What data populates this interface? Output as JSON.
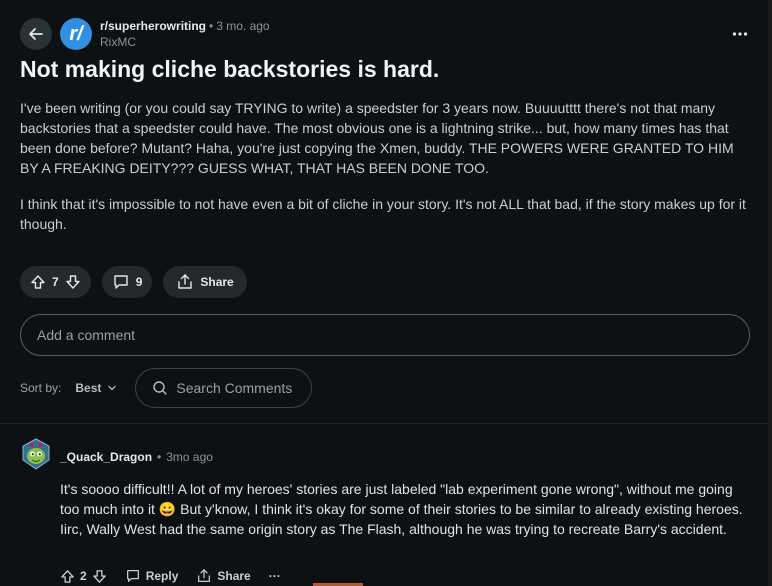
{
  "post": {
    "subreddit": "r/superherowriting",
    "age": "3 mo. ago",
    "author": "RixMC",
    "title": "Not making cliche backstories is hard.",
    "paragraphs": [
      "I've been writing (or you could say TRYING to write) a speedster for 3 years now. Buuuutttt there's not that many backstories that a speedster could have. The most obvious one is a lightning strike... but, how many times has that been done before? Mutant? Haha, you're just copying the Xmen, buddy. THE POWERS WERE GRANTED TO HIM BY A FREAKING DEITY??? GUESS WHAT, THAT HAS BEEN DONE TOO.",
      "I think that it's impossible to not have even a bit of cliche in your story. It's not ALL that bad, if the story makes up for it though."
    ],
    "avatar_letter": "r/",
    "votes": "7",
    "comments": "9",
    "share_label": "Share"
  },
  "comment_box": {
    "placeholder": "Add a comment"
  },
  "sort": {
    "label": "Sort by:",
    "value": "Best",
    "search_placeholder": "Search Comments"
  },
  "comment": {
    "user": "_Quack_Dragon",
    "age": "3mo ago",
    "text": "It's soooo difficult!! A lot of my heroes' stories are just labeled \"lab experiment gone wrong\", without me going too much into it 😀  But y'know, I think it's okay for some of their stories to be similar to already existing heroes. Iirc, Wally West had the same origin story as The Flash, although he was trying to recreate Barry's accident.",
    "votes": "2",
    "reply_label": "Reply",
    "share_label": "Share",
    "more": "···"
  },
  "colors": {
    "subreddit_avatar": "#2f8fe0",
    "background": "#0e1113",
    "pill": "#23292c"
  }
}
